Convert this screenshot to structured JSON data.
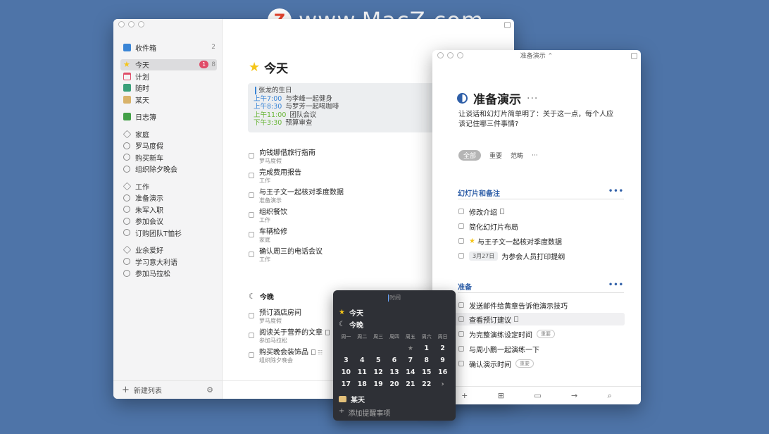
{
  "watermark": {
    "logo": "Z",
    "text": "www.MacZ.com"
  },
  "sidebar": {
    "inbox": {
      "label": "收件箱",
      "count": "2",
      "icon": "inbox-icon",
      "color": "#3a85d6"
    },
    "today": {
      "label": "今天",
      "badge": "1",
      "count": "8",
      "icon": "star-icon",
      "color": "#f5c518"
    },
    "upcoming": {
      "label": "计划",
      "icon": "calendar-icon",
      "color": "#e04c68"
    },
    "anytime": {
      "label": "随时",
      "icon": "layers-icon",
      "color": "#3aa07a"
    },
    "someday": {
      "label": "某天",
      "icon": "archive-box-icon",
      "color": "#d9b36a"
    },
    "logbook": {
      "label": "日志簿",
      "icon": "logbook-icon",
      "color": "#43a047"
    },
    "areas": [
      {
        "label": "家庭",
        "projects": [
          "罗马度假",
          "购买新车",
          "组织除夕晚会"
        ]
      },
      {
        "label": "工作",
        "projects": [
          "准备演示",
          "朱军入职",
          "参加会议",
          "订购团队T恤衫"
        ]
      },
      {
        "label": "业余爱好",
        "projects": [
          "学习意大利语",
          "参加马拉松"
        ]
      }
    ],
    "footer": {
      "new_list": "新建列表",
      "plus": "+",
      "settings": "⚙"
    }
  },
  "today_view": {
    "title": "今天",
    "calendar": [
      {
        "time": "",
        "text": "张龙的生日"
      },
      {
        "time": "上午7:00",
        "text": "与李峰一起健身"
      },
      {
        "time": "上午8:30",
        "text": "与罗芳一起喝咖啡"
      },
      {
        "time": "上午11:00",
        "text": "团队会议"
      },
      {
        "time": "下午3:30",
        "text": "预算审查"
      }
    ],
    "tasks": [
      {
        "title": "向钱娜借旅行指南",
        "project": "罗马度假"
      },
      {
        "title": "完成费用报告",
        "project": "工作"
      },
      {
        "title": "与王子文一起核对季度数据",
        "project": "准备演示"
      },
      {
        "title": "组织餐饮",
        "project": "工作"
      },
      {
        "title": "车辆检修",
        "project": "家庭"
      },
      {
        "title": "确认周三的电话会议",
        "project": "工作"
      }
    ],
    "tonight": {
      "label": "今晚",
      "tasks": [
        {
          "title": "预订酒店房间",
          "project": "罗马度假"
        },
        {
          "title": "阅读关于营养的文章",
          "project": "参加马拉松"
        },
        {
          "title": "购买晚会装饰品",
          "project": "组织除夕晚会"
        }
      ]
    },
    "footer_plus": "+"
  },
  "project_window": {
    "titlebar": "准备演示 ⌃",
    "title": "准备演示",
    "more": "···",
    "notes": "让谈话和幻灯片简单明了：关于这一点，每个人应该记住哪三件事情?",
    "filters": [
      "全部",
      "重要",
      "范畴",
      "···"
    ],
    "headings": [
      {
        "label": "幻灯片和备注",
        "more": "•••",
        "tasks": [
          {
            "title": "修改介绍",
            "has_note": true
          },
          {
            "title": "简化幻灯片布局"
          },
          {
            "title": "与王子文一起核对季度数据",
            "starred": true
          },
          {
            "title": "为参会人员打印提纲",
            "date": "3月27日"
          }
        ]
      },
      {
        "label": "准备",
        "more": "•••",
        "tasks": [
          {
            "title": "发送邮件给黄章告诉他演示技巧"
          },
          {
            "title": "查看预订建议",
            "has_note": true
          },
          {
            "title": "为完整演练设定时间",
            "tag": "重要"
          },
          {
            "title": "与周小鹏一起演练一下"
          },
          {
            "title": "确认演示时间",
            "tag": "重要"
          }
        ]
      }
    ],
    "footer": [
      "+",
      "⊞",
      "▭",
      "→",
      "⌕"
    ]
  },
  "popover": {
    "search_placeholder": "时间",
    "today": "今天",
    "tonight": "今晚",
    "weekdays": [
      "周一",
      "周二",
      "周三",
      "周四",
      "周五",
      "周六",
      "周日"
    ],
    "days": [
      "",
      "",
      "",
      "",
      "★",
      "1",
      "2",
      "3",
      "4",
      "5",
      "6",
      "7",
      "8",
      "9",
      "10",
      "11",
      "12",
      "13",
      "14",
      "15",
      "16",
      "17",
      "18",
      "19",
      "20",
      "21",
      "22",
      "›"
    ],
    "someday": "某天",
    "add_reminder": "添加提醒事项",
    "add_plus": "+"
  }
}
